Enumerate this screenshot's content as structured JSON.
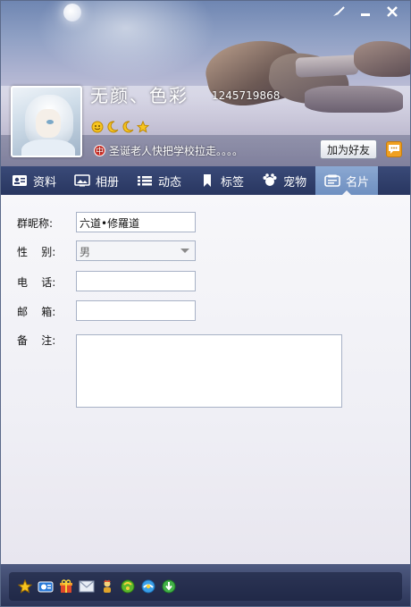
{
  "header": {
    "nickname": "无颜、色彩",
    "qq_number": "1245719868",
    "signature": "圣诞老人快把学校拉走。。。。",
    "signature_icon_text": "中",
    "add_friend_label": "加为好友",
    "level_icons": [
      "smile-icon",
      "moon-icon",
      "moon-icon",
      "star-icon"
    ]
  },
  "window_controls": [
    "skin-icon",
    "minimize-icon",
    "close-icon"
  ],
  "tabs": [
    {
      "label": "资料",
      "icon": "profile-card-icon",
      "active": false
    },
    {
      "label": "相册",
      "icon": "album-icon",
      "active": false
    },
    {
      "label": "动态",
      "icon": "feed-icon",
      "active": false
    },
    {
      "label": "标签",
      "icon": "tag-icon",
      "active": false
    },
    {
      "label": "宠物",
      "icon": "pet-icon",
      "active": false
    },
    {
      "label": "名片",
      "icon": "card-icon",
      "active": true
    }
  ],
  "form": {
    "group_nick_label": "群昵称:",
    "group_nick_value": "六道•修羅道",
    "gender_label": "性    别:",
    "gender_value": "男",
    "phone_label": "电    话:",
    "phone_value": "",
    "email_label": "邮    箱:",
    "email_value": "",
    "note_label": "备    注:",
    "note_value": ""
  },
  "footer_icons": [
    "star-icon",
    "qq-mail-icon",
    "gift-icon",
    "envelope-icon",
    "figure-icon",
    "green-ball-icon",
    "qq-browser-icon",
    "download-arrow-icon"
  ],
  "colors": {
    "tab_bar": "#2f3d6b",
    "tab_active": "#7b9bc9",
    "footer": "#3b4569",
    "field_border": "#a8b2c6"
  }
}
